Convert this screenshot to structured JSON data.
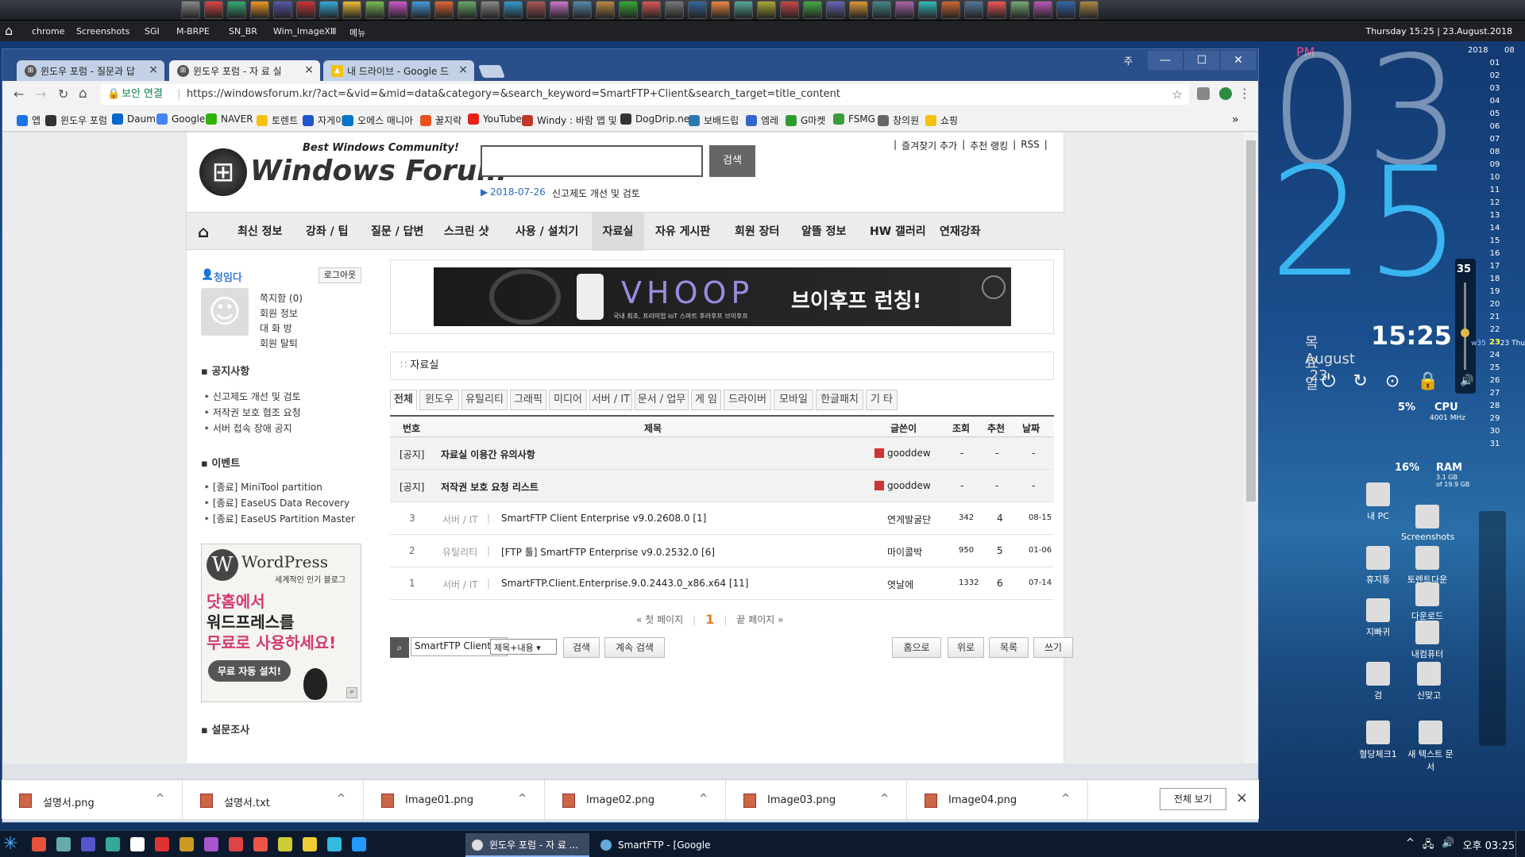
{
  "launch_bar": {
    "items": [
      "chrome",
      "Screenshots",
      "SGI",
      "M-BRPE",
      "SN_BR",
      "Wim_ImageXⅢ",
      "메뉴"
    ],
    "datetime": "Thursday 15:25 | 23.August.2018"
  },
  "browser": {
    "tabs": [
      {
        "title": "윈도우 포럼 - 질문과 답",
        "close": "×"
      },
      {
        "title": "윈도우 포럼 - 자 료 실",
        "close": "×"
      },
      {
        "title": "내 드라이브 - Google 드",
        "close": "×"
      }
    ],
    "window_label": "주",
    "secure_label": "보안 연결",
    "url": "https://windowsforum.kr/?act=&vid=&mid=data&category=&search_keyword=SmartFTP+Client&search_target=title_content",
    "bookmarks": [
      "앱",
      "윈도우 포럼",
      "Daum",
      "Google",
      "NAVER",
      "토렌트",
      "자게이",
      "오에스 매니아",
      "꿀지락",
      "YouTube",
      "Windy : 바람 맵 및 일",
      "DogDrip.net",
      "보배드립",
      "엠레",
      "G마켓",
      "FSMG",
      "창의원",
      "쇼핑"
    ],
    "bookmarks_more": "»"
  },
  "site": {
    "tagline": "Best Windows Community!",
    "logo_text": "Windows Forum",
    "search_button": "검색",
    "notice_date": "2018-07-26",
    "notice_text": "신고제도 개선 및 검토",
    "top_links": [
      "즐겨찾기 추가",
      "추천 랭킹",
      "RSS"
    ],
    "nav": [
      "최신 정보",
      "강좌 / 팁",
      "질문 / 답변",
      "스크린 샷",
      "사용 / 설치기",
      "자료실",
      "자유 게시판",
      "회원 장터",
      "알뜰 정보",
      "HW 갤러리",
      "연재강좌"
    ]
  },
  "sidebar": {
    "username": "청임다",
    "logout": "로그아웃",
    "user_links": [
      "쪽지함 (0)",
      "회원 정보",
      "대 화 방",
      "회원 탈퇴"
    ],
    "notice_title": "공지사항",
    "notices": [
      "신고제도 개선 및 검토",
      "저작권 보호 협조 요청",
      "서버 접속 장애 공지"
    ],
    "event_title": "이벤트",
    "events": [
      "[종료] MiniTool partition",
      "[종료] EaseUS Data Recovery",
      "[종료] EaseUS Partition Master"
    ],
    "wp_ad": {
      "brand": "WordPress",
      "sub": "세계적인 인기 블로그",
      "line1": "닷홈에서",
      "line2": "워드프레스를",
      "line3": "무료로 사용하세요!",
      "cta": "무료 자동 설치!"
    },
    "survey_title": "설문조사"
  },
  "banner": {
    "brand": "VHOOP",
    "headline": "브이후프 런칭!",
    "sub": "국내 최초, 프리미엄 IoT 스마트 후라후프 브이후프"
  },
  "board": {
    "title": "자료실",
    "categories": [
      "전체",
      "윈도우",
      "유틸리티",
      "그래픽",
      "미디어",
      "서버 / IT",
      "문서 / 업무",
      "게 임",
      "드라이버",
      "모바일",
      "한글패치",
      "기 타"
    ],
    "headers": [
      "번호",
      "제목",
      "글쓴이",
      "조회",
      "추천",
      "날짜"
    ],
    "notices": [
      {
        "tag": "[공지]",
        "title": "자료실 이용간 유의사항",
        "author": "gooddew",
        "views": "-",
        "votes": "-",
        "date": "-"
      },
      {
        "tag": "[공지]",
        "title": "저작권 보호 요청 리스트",
        "author": "gooddew",
        "views": "-",
        "votes": "-",
        "date": "-"
      }
    ],
    "rows": [
      {
        "no": "3",
        "cat": "서버 / IT",
        "title": "SmartFTP Client Enterprise v9.0.2608.0 [1]",
        "author": "연게발굴단",
        "views": "342",
        "votes": "4",
        "date": "08-15"
      },
      {
        "no": "2",
        "cat": "유틸리티",
        "title": "[FTP 툴] SmartFTP Enterprise v9.0.2532.0 [6]",
        "author": "마이콜박",
        "views": "950",
        "votes": "5",
        "date": "01-06"
      },
      {
        "no": "1",
        "cat": "서버 / IT",
        "title": "SmartFTP.Client.Enterprise.9.0.2443.0_x86.x64 [11]",
        "author": "엿날에",
        "views": "1332",
        "votes": "6",
        "date": "07-14"
      }
    ],
    "pager": {
      "first": "« 첫 페이지",
      "current": "1",
      "last": "끝 페이지 »"
    },
    "search_value": "SmartFTP Client",
    "search_target": "제목+내용",
    "search_btn": "검색",
    "continue_btn": "계속 검색",
    "actions": [
      "홈으로",
      "위로",
      "목록",
      "쓰기"
    ]
  },
  "downloads": {
    "files": [
      "설명서.png",
      "설명서.txt",
      "Image01.png",
      "Image02.png",
      "Image03.png",
      "Image04.png"
    ],
    "show_all": "전체 보기",
    "close": "×"
  },
  "taskbar": {
    "tasks": [
      "윈도우 포럼 - 자 료 ...",
      "SmartFTP - [Google ..."
    ],
    "tray_time": "오후 03:25"
  },
  "desktop": {
    "ampm": "PM",
    "hour": "03",
    "minute": "25",
    "weekday": "목요일",
    "date": "August .23",
    "time": "15:25",
    "volume": "35",
    "cpu_pct": "5%",
    "cpu_label": "CPU",
    "cpu_freq": "4001 MHz",
    "ram_pct": "16%",
    "ram_label": "RAM",
    "ram_used": "3.1 GB",
    "ram_total": "of 19.9 GB",
    "cal_year": "2018",
    "cal_month": "08",
    "cal_days": [
      "01",
      "02",
      "03",
      "04",
      "05",
      "06",
      "07",
      "08",
      "09",
      "10",
      "11",
      "12",
      "13",
      "14",
      "15",
      "16",
      "17",
      "18",
      "19",
      "20",
      "21",
      "22",
      "23",
      "24",
      "25",
      "26",
      "27",
      "28",
      "29",
      "30",
      "31"
    ],
    "week_label": "w35",
    "today_label": "23 Thu",
    "icons": [
      "내 PC",
      "Screenshots",
      "토렌트다운",
      "휴지통",
      "다운로드",
      "지빠귀",
      "내컴퓨터",
      "검",
      "신맞고",
      "혈당체크1",
      "새 텍스트 문서"
    ]
  }
}
